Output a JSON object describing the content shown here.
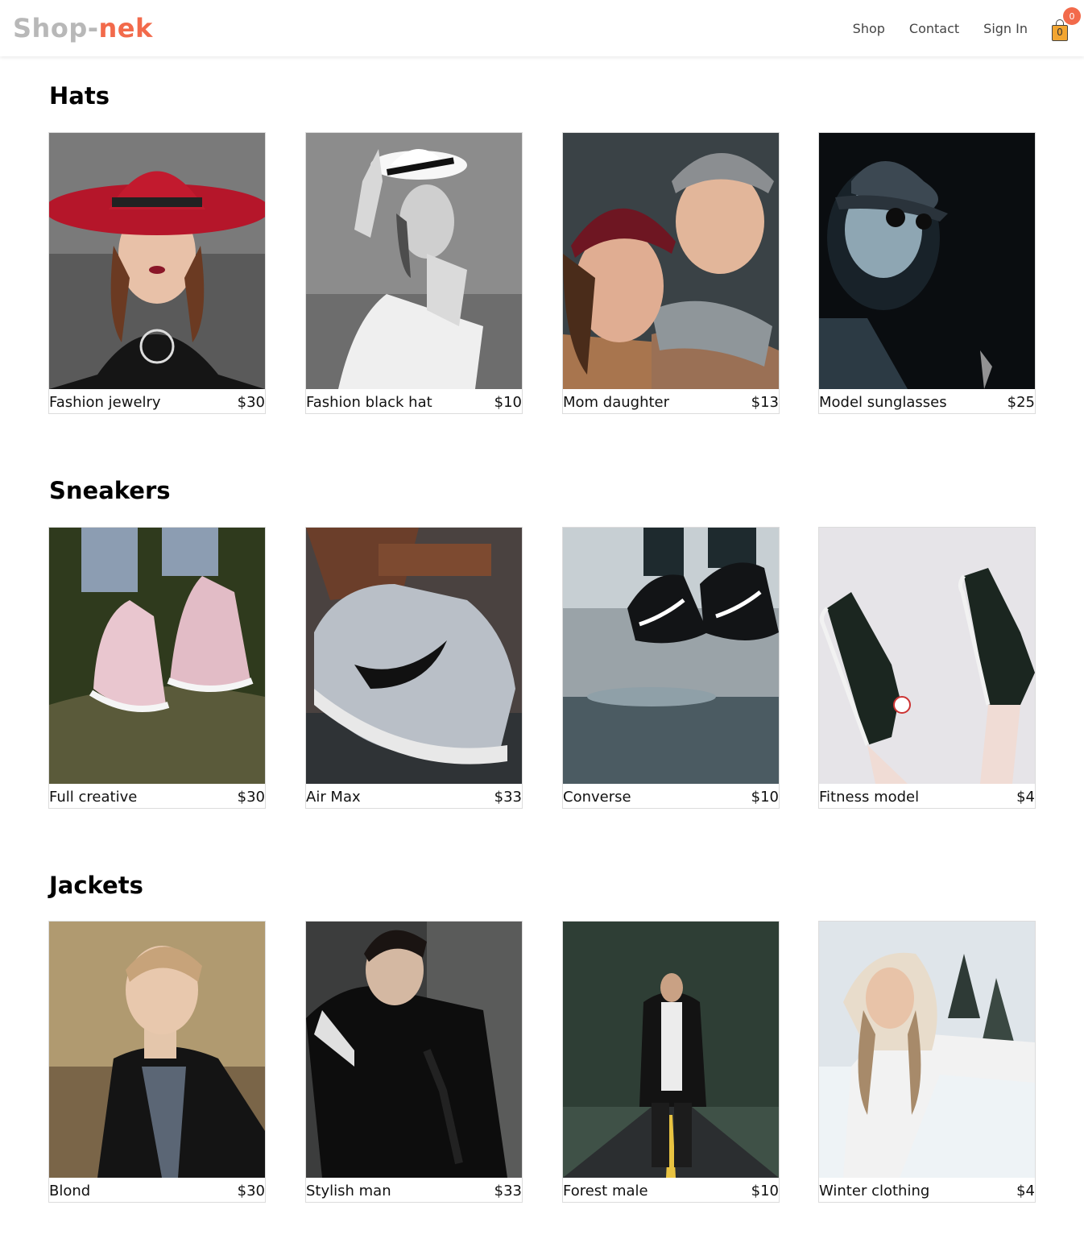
{
  "brand": {
    "part1": "Shop-",
    "part2": "nek"
  },
  "nav": {
    "shop": "Shop",
    "contact": "Contact",
    "signin": "Sign In",
    "cart_count": "0",
    "badge_count": "0"
  },
  "sections": [
    {
      "title": "Hats",
      "items": [
        {
          "name": "Fashion jewelry",
          "price": "$30"
        },
        {
          "name": "Fashion black hat",
          "price": "$10"
        },
        {
          "name": "Mom daughter",
          "price": "$13"
        },
        {
          "name": "Model sunglasses",
          "price": "$25"
        }
      ]
    },
    {
      "title": "Sneakers",
      "items": [
        {
          "name": "Full creative",
          "price": "$30"
        },
        {
          "name": "Air Max",
          "price": "$33"
        },
        {
          "name": "Converse",
          "price": "$10"
        },
        {
          "name": "Fitness model",
          "price": "$4"
        }
      ]
    },
    {
      "title": "Jackets",
      "items": [
        {
          "name": "Blond",
          "price": "$30"
        },
        {
          "name": "Stylish man",
          "price": "$33"
        },
        {
          "name": "Forest male",
          "price": "$10"
        },
        {
          "name": "Winter clothing",
          "price": "$4"
        }
      ]
    }
  ]
}
